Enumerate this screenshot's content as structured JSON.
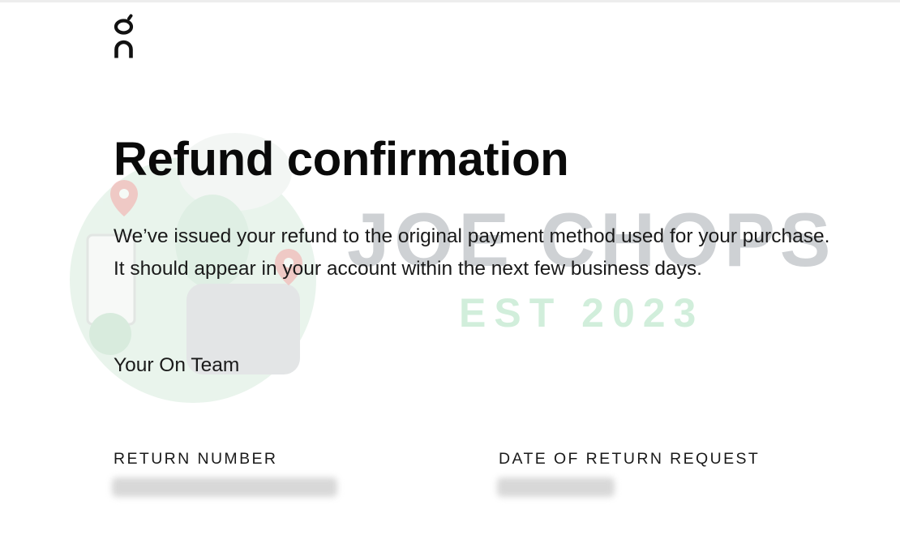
{
  "brand": {
    "logo_name": "on-logo",
    "logo_color": "#111111"
  },
  "watermark": {
    "text_line1": "JOE CHOPS",
    "text_line2": "EST 2023",
    "line1_color": "#a7acb1",
    "line2_color": "#c9ecd5",
    "globe_color": "#cfe7d6",
    "pin_color": "#f4a6a6"
  },
  "email": {
    "title": "Refund confirmation",
    "message_lines": [
      "We’ve issued your refund to the original payment method used for your purchase.",
      "It should appear in your account within the next few business days."
    ],
    "signoff": "Your On Team"
  },
  "details": {
    "return_number_label": "RETURN NUMBER",
    "return_number_value": "",
    "date_label": "DATE OF RETURN REQUEST",
    "date_value": ""
  }
}
